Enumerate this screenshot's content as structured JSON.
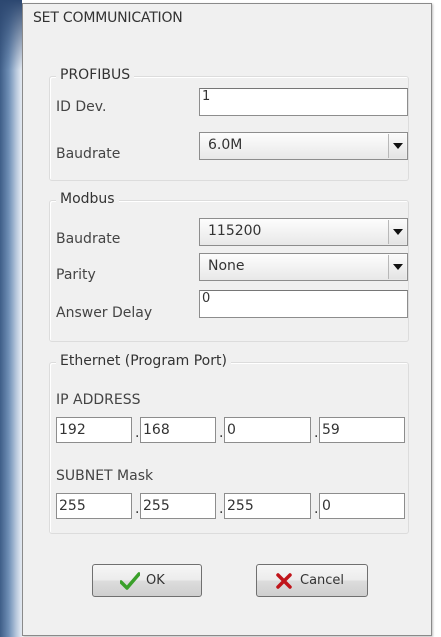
{
  "dialog": {
    "title": "SET COMMUNICATION"
  },
  "profibus": {
    "legend": "PROFIBUS",
    "id_dev_label": "ID Dev.",
    "id_dev_value": "1",
    "baudrate_label": "Baudrate",
    "baudrate_value": "6.0M"
  },
  "modbus": {
    "legend": "Modbus",
    "baudrate_label": "Baudrate",
    "baudrate_value": "115200",
    "parity_label": "Parity",
    "parity_value": "None",
    "answer_delay_label": "Answer Delay",
    "answer_delay_value": "0"
  },
  "ethernet": {
    "legend": "Ethernet (Program Port)",
    "ip_label": "IP ADDRESS",
    "ip": [
      "192",
      "168",
      "0",
      "59"
    ],
    "subnet_label": "SUBNET Mask",
    "subnet": [
      "255",
      "255",
      "255",
      "0"
    ]
  },
  "buttons": {
    "ok_label": "OK",
    "cancel_label": "Cancel",
    "ok_icon": "checkmark-icon",
    "cancel_icon": "x-icon",
    "ok_icon_color": "#3aa02a",
    "cancel_icon_color": "#c0141a"
  }
}
